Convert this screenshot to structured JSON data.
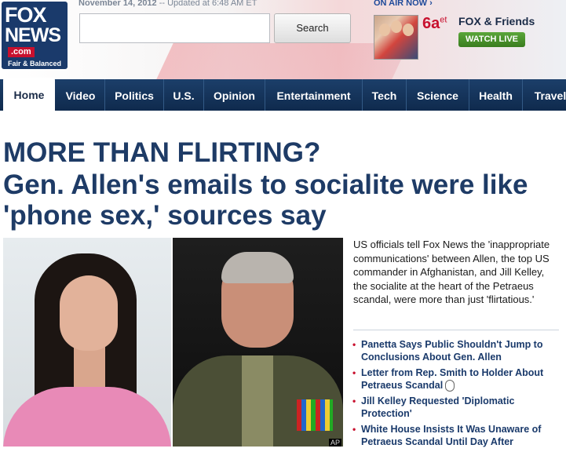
{
  "header": {
    "logo": {
      "fox": "FOX",
      "news": "NEWS",
      "com": ".com",
      "tagline": "Fair & Balanced"
    },
    "date": "November 14, 2012",
    "updated": "-- Updated at 6:48 AM ET",
    "search": {
      "value": "",
      "placeholder": "",
      "button_label": "Search"
    },
    "on_air": {
      "label": "ON AIR NOW ›",
      "time": "6a",
      "time_suffix": "et",
      "show": "FOX & Friends",
      "watch_label": "WATCH LIVE"
    }
  },
  "nav": {
    "items": [
      {
        "label": "Home",
        "active": true
      },
      {
        "label": "Video"
      },
      {
        "label": "Politics"
      },
      {
        "label": "U.S."
      },
      {
        "label": "Opinion"
      },
      {
        "label": "Entertainment"
      },
      {
        "label": "Tech"
      },
      {
        "label": "Science"
      },
      {
        "label": "Health"
      },
      {
        "label": "Travel"
      }
    ]
  },
  "main": {
    "kicker": "MORE THAN FLIRTING?",
    "headline": "Gen. Allen's emails to socialite were like 'phone sex,' sources say",
    "photo_credit": "AP",
    "summary": "US officials tell Fox News the 'inappropriate communications' between Allen, the top US commander in Afghanistan, and Jill Kelley, the socialite at the heart of the Petraeus scandal, were more than just 'flirtatious.'",
    "related_links": [
      {
        "label": "Panetta Says Public Shouldn't Jump to Conclusions About Gen. Allen"
      },
      {
        "label": "Letter from Rep. Smith to Holder About Petraeus Scandal"
      },
      {
        "label": "Jill Kelley Requested 'Diplomatic Protection'"
      },
      {
        "label": "White House Insists It Was Unaware of Petraeus Scandal Until Day After"
      }
    ]
  },
  "colors": {
    "brand_navy": "#1e3b66",
    "nav_bg": "#1c3f6a",
    "accent_red": "#c8102e",
    "watch_green": "#4a9a2c"
  }
}
